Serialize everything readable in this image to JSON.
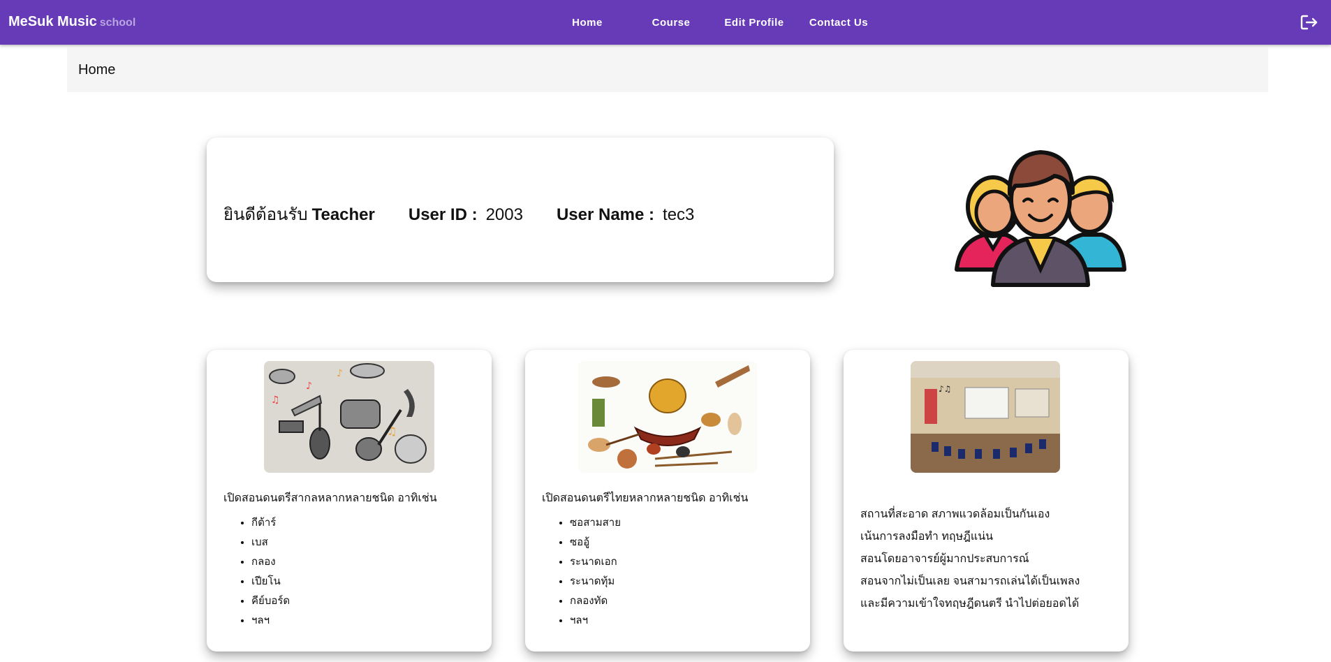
{
  "header": {
    "brand": "MeSuk Music",
    "brand_sub": "school",
    "nav": [
      "Home",
      "Course",
      "Edit Profile",
      "Contact Us"
    ],
    "bg_color": "#673ab7",
    "logout_icon": "logout-icon"
  },
  "breadcrumb": {
    "title": "Home"
  },
  "welcome": {
    "greeting": "ยินดีต้อนรับ",
    "role": "Teacher",
    "user_id_label": "User ID :",
    "user_id": "2003",
    "user_name_label": "User Name :",
    "user_name": "tec3"
  },
  "illustration": {
    "icon": "teachers-group-icon"
  },
  "cards": [
    {
      "image": "western-instruments-pattern",
      "intro": "เปิดสอนดนตรีสากลหลากหลายชนิด อาทิเช่น",
      "items": [
        "กีต้าร์",
        "เบส",
        "กลอง",
        "เปียโน",
        "คีย์บอร์ด",
        "ฯลฯ"
      ]
    },
    {
      "image": "thai-instruments-collage",
      "intro": "เปิดสอนดนตรีไทยหลากหลายชนิด อาทิเช่น",
      "items": [
        "ซอสามสาย",
        "ซออู้",
        "ระนาดเอก",
        "ระนาดทุ้ม",
        "กลองทัด",
        "ฯลฯ"
      ]
    },
    {
      "image": "music-classroom-photo",
      "lines": [
        "สถานที่สะอาด สภาพแวดล้อมเป็นกันเอง",
        "เน้นการลงมือทำ ทฤษฎีแน่น",
        "สอนโดยอาจารย์ผู้มากประสบการณ์",
        "สอนจากไม่เป็นเลย จนสามารถเล่นได้เป็นเพลง",
        "และมีความเข้าใจทฤษฎีดนตรี นำไปต่อยอดได้"
      ]
    }
  ]
}
